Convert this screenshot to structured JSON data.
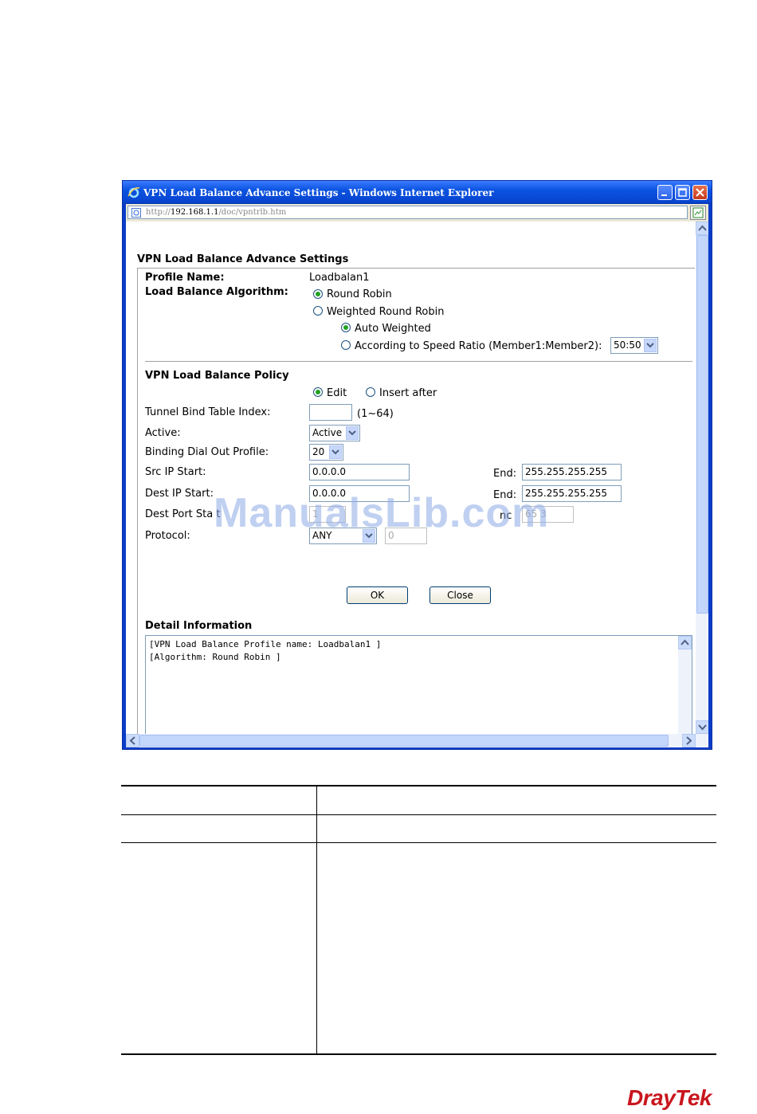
{
  "window": {
    "title": "VPN Load Balance Advance Settings - Windows Internet Explorer",
    "address_prefix": "http://",
    "address_host": "192.168.1.1",
    "address_path": "/doc/vpntrlb.htm"
  },
  "form": {
    "heading": "VPN Load Balance Advance Settings",
    "profile_name_label": "Profile Name:",
    "profile_name_value": "Loadbalan1",
    "algorithm_label": "Load Balance Algorithm:",
    "algorithms": [
      {
        "label": "Round Robin",
        "selected": true
      },
      {
        "label": "Weighted Round Robin",
        "selected": false
      }
    ],
    "weight_options": [
      {
        "label": "Auto Weighted",
        "selected": true
      },
      {
        "label": "According to Speed Ratio (Member1:Member2):",
        "selected": false
      }
    ],
    "speed_ratio_value": "50:50",
    "policy_heading": "VPN Load Balance Policy",
    "policy_modes": [
      {
        "label": "Edit",
        "selected": true
      },
      {
        "label": "Insert after",
        "selected": false
      }
    ],
    "tunnel_index_label": "Tunnel Bind Table Index:",
    "tunnel_index_value": "",
    "tunnel_index_range": "(1~64)",
    "active_label": "Active:",
    "active_value": "Active",
    "binding_label": "Binding Dial Out Profile:",
    "binding_value": "20",
    "src_ip_label": "Src IP Start:",
    "src_ip_start": "0.0.0.0",
    "src_end_label": "End:",
    "src_ip_end": "255.255.255.255",
    "dest_ip_label": "Dest IP Start:",
    "dest_ip_start": "0.0.0.0",
    "dest_end_label": "End:",
    "dest_ip_end": "255.255.255.255",
    "dest_port_label": "Dest Port Sta",
    "dest_port_label_tail": "t",
    "dest_port_start": "1",
    "dest_port_end_label": "nc",
    "dest_port_end": "65 3",
    "protocol_label": "Protocol:",
    "protocol_value": "ANY",
    "protocol_number": "0",
    "ok_label": "OK",
    "close_label": "Close",
    "detail_heading": "Detail Information",
    "detail_lines": [
      "[VPN Load Balance Profile name: Loadbalan1 ]",
      "[Algorithm: Round Robin ]"
    ]
  },
  "watermark": "ManualsLib.com",
  "logo": "DrayTek",
  "colors": {
    "titlebar": "#0a52e0",
    "radio_dot": "#21a121",
    "logo_red": "#c8161d"
  }
}
